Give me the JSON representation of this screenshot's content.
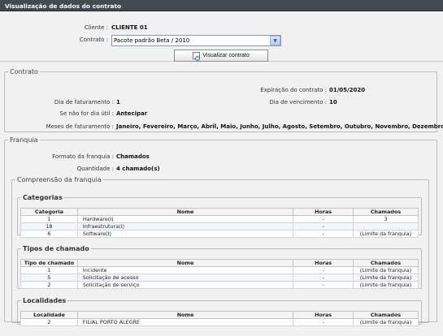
{
  "window": {
    "title": "Visualização de dados do contrato"
  },
  "header": {
    "client_label": "Cliente :",
    "client_value": "CLIENTE 01",
    "contract_label": "Contrato :",
    "contract_selected": "Pacote padrão Beta / 2010",
    "view_button": "Visualizar contrato"
  },
  "contrato": {
    "legend": "Contrato",
    "expiration_label": "Expiração do contrato :",
    "expiration_value": "01/05/2020",
    "billing_day_label": "Dia de faturamento :",
    "billing_day_value": "1",
    "due_day_label": "Dia de vencimento :",
    "due_day_value": "10",
    "non_business_label": "Se não for dia útil :",
    "non_business_value": "Antecipar",
    "months_label": "Meses de faturamento :",
    "months_value": "Janeiro, Fevereiro, Março, Abril, Maio, Junho, Julho, Agosto, Setembro, Outubro, Novembro, Dezembro"
  },
  "franquia": {
    "legend": "Franquia",
    "format_label": "Formato da franquia :",
    "format_value": "Chamados",
    "quantity_label": "Quantidade :",
    "quantity_value": "4 chamado(s)",
    "compreensao_legend": "Compreensão da franquia",
    "categorias": {
      "legend": "Categorias",
      "columns": [
        "Categoria",
        "Nome",
        "Horas",
        "Chamados"
      ],
      "rows": [
        [
          "1",
          "Hardware(I)",
          "-",
          "3"
        ],
        [
          "18",
          "Infraestrutura(I)",
          "-",
          ""
        ],
        [
          "6",
          "Software(I)",
          "-",
          "(Limite da franquia)"
        ]
      ]
    },
    "tipos": {
      "legend": "Tipos de chamado",
      "columns": [
        "Tipo de chamado",
        "Nome",
        "Horas",
        "Chamados"
      ],
      "rows": [
        [
          "1",
          "Incidente",
          "-",
          "(Limite da franquia)"
        ],
        [
          "5",
          "Solicitação de acesso",
          "-",
          "(Limite da franquia)"
        ],
        [
          "2",
          "Solicitação de serviço",
          "-",
          "(Limite da franquia)"
        ]
      ]
    },
    "localidades": {
      "legend": "Localidades",
      "columns": [
        "Localidade",
        "Nome",
        "Horas",
        "Chamados"
      ],
      "rows": [
        [
          "2",
          "FILIAL PORTO ALEGRE",
          "-",
          "(Limite da franquia)"
        ]
      ]
    }
  },
  "colors": {
    "titlebar": "#444a52",
    "alt_row": "#f3f6ff"
  },
  "icons": {
    "view_button_icon": "document-search-icon",
    "select_arrow": "chevron-down-icon"
  }
}
